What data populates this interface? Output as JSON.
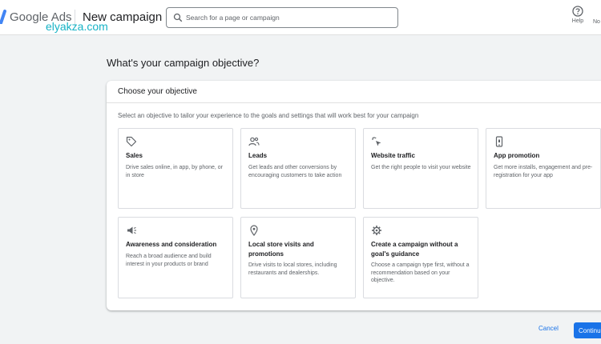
{
  "header": {
    "brand": "Google Ads",
    "page_title": "New campaign",
    "search_placeholder": "Search for a page or campaign",
    "help_label": "Help",
    "notifications_label": "No",
    "watermark": "elyakza.com"
  },
  "main": {
    "heading": "What's your campaign objective?",
    "card_title": "Choose your objective",
    "intro": "Select an objective to tailor your experience to the goals and settings that will work best for your campaign",
    "objectives": [
      {
        "icon": "tag-icon",
        "title": "Sales",
        "description": "Drive sales online, in app, by phone, or in store"
      },
      {
        "icon": "people-icon",
        "title": "Leads",
        "description": "Get leads and other conversions by encouraging customers to take action"
      },
      {
        "icon": "cursor-click-icon",
        "title": "Website traffic",
        "description": "Get the right people to visit your website"
      },
      {
        "icon": "phone-icon",
        "title": "App promotion",
        "description": "Get more installs, engagement and pre-registration for your app"
      },
      {
        "icon": "megaphone-icon",
        "title": "Awareness and consideration",
        "description": "Reach a broad audience and build interest in your products or brand"
      },
      {
        "icon": "location-pin-icon",
        "title": "Local store visits and promotions",
        "description": "Drive visits to local stores, including restaurants and dealerships."
      },
      {
        "icon": "gear-icon",
        "title": "Create a campaign without a goal's guidance",
        "description": "Choose a campaign type first, without a recommendation based on your objective."
      }
    ]
  },
  "footer": {
    "cancel_label": "Cancel",
    "continue_label": "Continue"
  },
  "colors": {
    "accent": "#1a73e8",
    "background": "#f1f3f4",
    "watermark": "#17b3c6"
  }
}
